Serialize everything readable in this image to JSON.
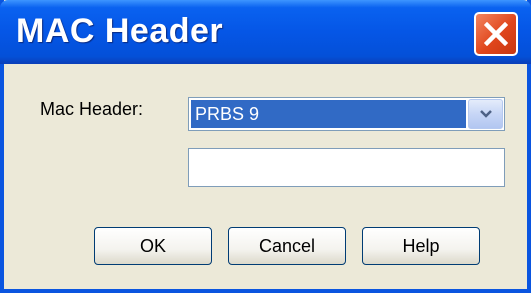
{
  "window": {
    "title": "MAC Header"
  },
  "form": {
    "label": "Mac Header:",
    "selected": "PRBS 9",
    "text_value": ""
  },
  "buttons": {
    "ok": "OK",
    "cancel": "Cancel",
    "help": "Help"
  },
  "icons": {
    "close": "close-icon",
    "dropdown": "chevron-down-icon"
  },
  "colors": {
    "titlebar": "#0556e6",
    "close": "#e0461c",
    "selection": "#316ac5",
    "dialog_bg": "#ece9d8"
  }
}
